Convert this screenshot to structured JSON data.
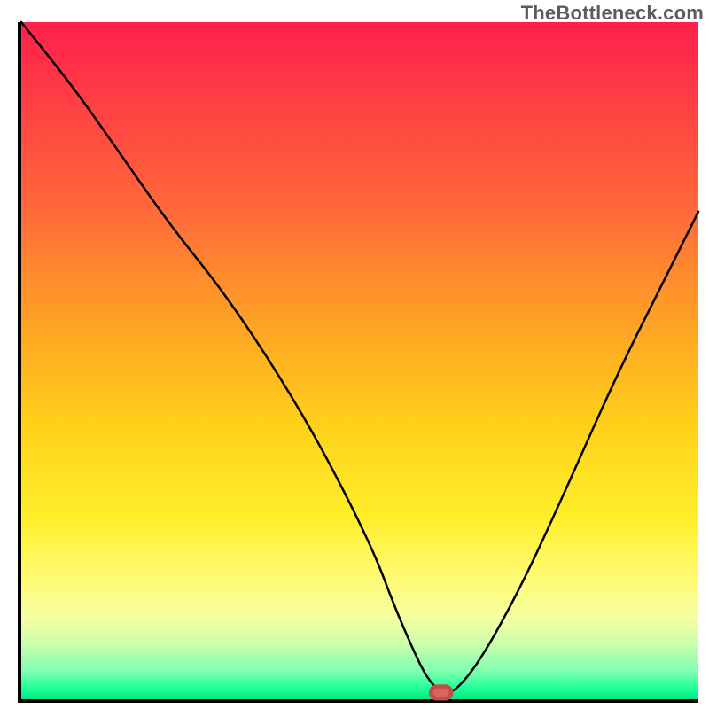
{
  "watermark": "TheBottleneck.com",
  "chart_data": {
    "type": "line",
    "title": "",
    "xlabel": "",
    "ylabel": "",
    "xlim": [
      0,
      100
    ],
    "ylim": [
      0,
      100
    ],
    "grid": false,
    "series": [
      {
        "name": "bottleneck-curve",
        "x": [
          0,
          8,
          15,
          22,
          30,
          38,
          45,
          52,
          55,
          58,
          60,
          62,
          64,
          68,
          74,
          80,
          88,
          95,
          100
        ],
        "values": [
          100,
          90,
          80,
          70,
          60,
          48,
          36,
          22,
          14,
          7,
          3,
          1,
          1,
          6,
          17,
          30,
          48,
          62,
          72
        ]
      }
    ],
    "marker": {
      "x": 62,
      "y": 1,
      "shape": "pill",
      "color": "#d9655b"
    },
    "background_gradient": {
      "direction": "vertical",
      "stops": [
        {
          "pos": 0,
          "color": "#ff1f4b"
        },
        {
          "pos": 45,
          "color": "#ffa424"
        },
        {
          "pos": 73,
          "color": "#ffee2a"
        },
        {
          "pos": 92,
          "color": "#c8ffab"
        },
        {
          "pos": 100,
          "color": "#00e887"
        }
      ]
    }
  }
}
